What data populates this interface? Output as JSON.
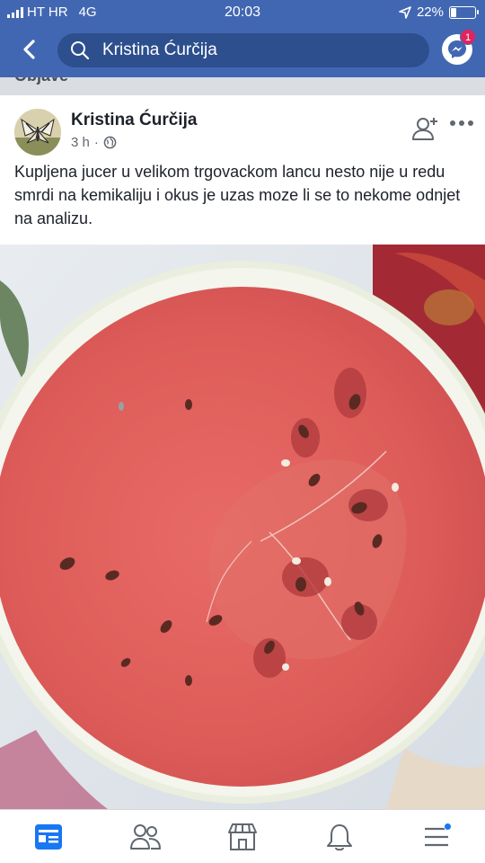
{
  "status_bar": {
    "carrier": "HT HR",
    "network": "4G",
    "time": "20:03",
    "battery": "22%",
    "battery_level": 0.22
  },
  "header": {
    "search_text": "Kristina Ćurčija",
    "messenger_badge": "1"
  },
  "strip": {
    "label": "Objave"
  },
  "post": {
    "author": "Kristina Ćurčija",
    "time": "3 h",
    "separator": "·",
    "text": "Kupljena jucer u velikom trgovackom lancu nesto nije u redu smrdi na kemikaliju i okus je uzas moze li se to nekome odnjet na analizu."
  },
  "icons": {
    "back": "chevron-left-icon",
    "search": "search-icon",
    "messenger": "messenger-icon",
    "add_friend": "add-friend-icon",
    "more": "more-icon",
    "privacy": "globe-icon",
    "tabs": [
      "news-feed-icon",
      "friends-icon",
      "marketplace-icon",
      "notifications-icon",
      "menu-icon"
    ]
  },
  "colors": {
    "brand_blue": "#4267b2",
    "search_bg": "#2d4f8e",
    "active_tab": "#1877f2",
    "badge_red": "#e0245e",
    "watermelon_flesh": "#e0625d",
    "watermelon_rind": "#eef1e3"
  }
}
